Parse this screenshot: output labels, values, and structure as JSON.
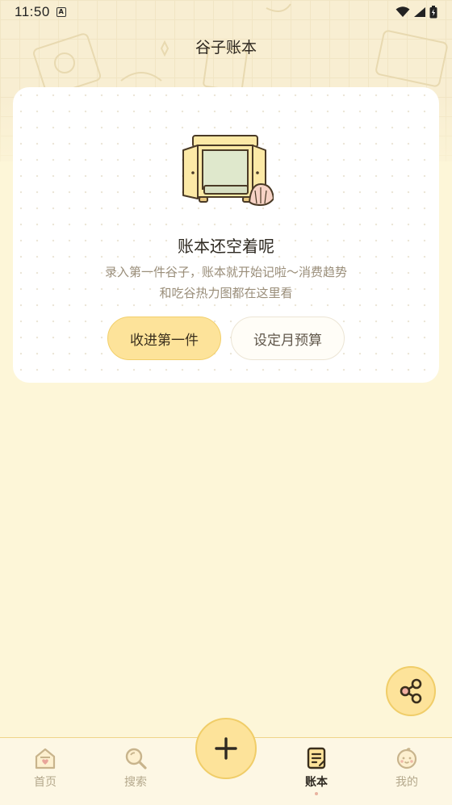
{
  "status_bar": {
    "time": "11:50",
    "notification_icon": "a-badge-icon",
    "wifi_icon": "wifi-icon",
    "signal_icon": "signal-icon",
    "battery_icon": "battery-icon"
  },
  "header": {
    "title": "谷子账本"
  },
  "empty_state": {
    "illustration": "cabinet-with-shell-icon",
    "title": "账本还空着呢",
    "description_line1": "录入第一件谷子，账本就开始记啦～消费趋势",
    "description_line2": "和吃谷热力图都在这里看",
    "primary_button": "收进第一件",
    "secondary_button": "设定月预算"
  },
  "share_button": {
    "icon": "share-icon"
  },
  "tab_bar": {
    "add_button_icon": "plus-icon",
    "tabs": [
      {
        "label": "首页",
        "icon": "home-icon",
        "active": false
      },
      {
        "label": "搜索",
        "icon": "search-icon",
        "active": false
      },
      {
        "label": "账本",
        "icon": "ledger-icon",
        "active": true
      },
      {
        "label": "我的",
        "icon": "face-icon",
        "active": false
      }
    ]
  },
  "colors": {
    "background": "#fdf6d8",
    "accent": "#fde39a",
    "accent_border": "#f0cd68",
    "muted_text": "#9a8e7a"
  }
}
